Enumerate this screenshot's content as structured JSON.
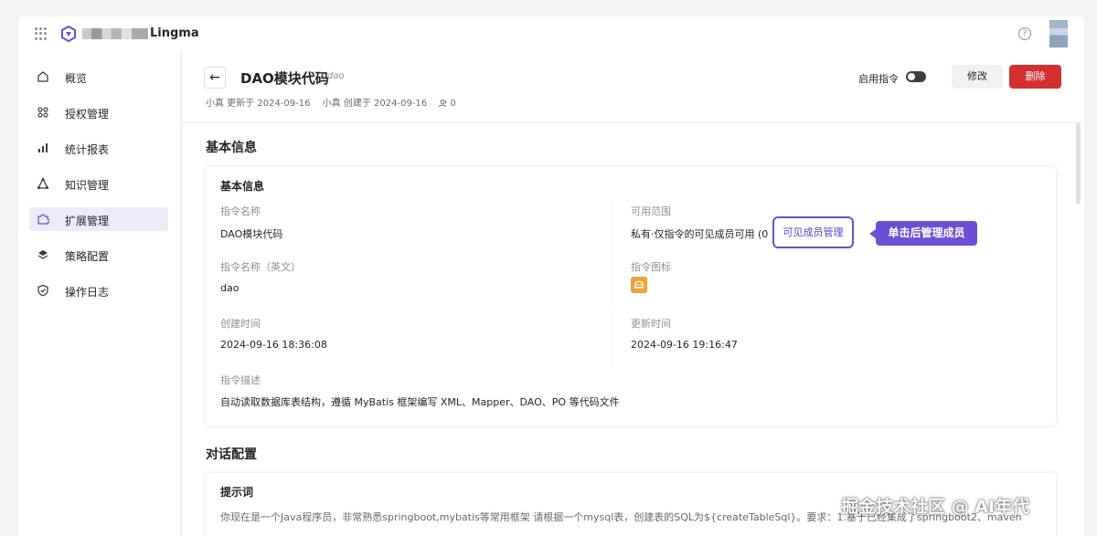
{
  "topbar": {
    "brand": "Lingma",
    "help_icon": "help-circle-icon"
  },
  "sidebar": {
    "items": [
      {
        "label": "概览",
        "icon": "home-icon"
      },
      {
        "label": "授权管理",
        "icon": "grid-apps-icon"
      },
      {
        "label": "统计报表",
        "icon": "bar-chart-icon"
      },
      {
        "label": "知识管理",
        "icon": "nodes-icon"
      },
      {
        "label": "扩展管理",
        "icon": "puzzle-icon",
        "active": true
      },
      {
        "label": "策略配置",
        "icon": "layers-icon"
      },
      {
        "label": "操作日志",
        "icon": "shield-check-icon"
      }
    ]
  },
  "header": {
    "title": "DAO模块代码",
    "subtitle": "dao",
    "updated": "小真 更新于 2024-09-16",
    "created": "小真 创建于 2024-09-16",
    "users_count": "0",
    "toggle_label": "启用指令",
    "toggle_on": false,
    "edit_label": "修改",
    "delete_label": "删除"
  },
  "basic": {
    "section_title": "基本信息",
    "card_title": "基本信息",
    "name_label": "指令名称",
    "name_value": "DAO模块代码",
    "scope_label": "可用范围",
    "scope_value": "私有·仅指令的可见成员可用 (0",
    "member_btn": "可见成员管理",
    "callout": "单击后管理成员",
    "en_name_label": "指令名称（英文）",
    "en_name_value": "dao",
    "icon_label": "指令图标",
    "created_label": "创建时间",
    "created_value": "2024-09-16 18:36:08",
    "updated_label": "更新时间",
    "updated_value": "2024-09-16 19:16:47",
    "desc_label": "指令描述",
    "desc_value": "自动读取数据库表结构，遵循 MyBatis 框架编写 XML、Mapper、DAO、PO 等代码文件"
  },
  "dialog": {
    "section_title": "对话配置",
    "card_title": "提示词",
    "prompt_text": "你现在是一个Java程序员，非常熟悉springboot,mybatis等常用框架 请根据一个mysql表，创建表的SQL为${createTableSql}。要求：1.基于已经集成了springboot2、maven"
  },
  "watermark": "掘金技术社区 @ AI年代",
  "colors": {
    "accent": "#6c4fd3",
    "danger": "#d3302f",
    "icon_orange": "#f0a33a"
  }
}
